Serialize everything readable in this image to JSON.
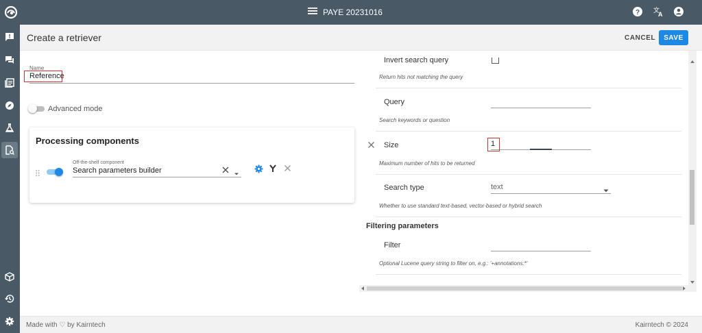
{
  "app": {
    "title": "PAYE 20231016"
  },
  "topbar": {
    "menu_icon": "menu-icon",
    "icons": [
      "help-icon",
      "translate-icon",
      "account-icon"
    ]
  },
  "sidebar": {
    "items": [
      "feedback-icon",
      "forum-icon",
      "documents-icon",
      "explore-icon",
      "flask-icon",
      "retriever-icon",
      "cube-icon",
      "history-icon",
      "settings-icon"
    ],
    "active": "retriever-icon"
  },
  "header": {
    "title": "Create a retriever",
    "cancel_label": "CANCEL",
    "save_label": "SAVE"
  },
  "form": {
    "name_label": "Name",
    "name_value": "Reference",
    "advanced_mode_label": "Advanced mode",
    "advanced_mode_on": false
  },
  "processing": {
    "title": "Processing components",
    "component_label": "Off-the-shelf component",
    "component_value": "Search parameters builder",
    "enabled": true
  },
  "params": {
    "invert": {
      "label": "Invert search query",
      "hint": "Return hits not matching the query",
      "checked": false
    },
    "query": {
      "label": "Query",
      "hint": "Search keywords or question",
      "value": ""
    },
    "size": {
      "label": "Size",
      "hint": "Maximum number of hits to be returned",
      "value": "1"
    },
    "search_type": {
      "label": "Search type",
      "hint": "Whether to use standard text-based, vector-based or hybrid search",
      "value": "text"
    },
    "filtering_title": "Filtering parameters",
    "filter": {
      "label": "Filter",
      "hint": "Optional Lucene query string to filter on, e.g.: '+annotations:*'",
      "value": ""
    }
  },
  "footer": {
    "made_with": "Made with ♡ by Kairntech",
    "copyright": "Kairntech © 2024"
  },
  "colors": {
    "topbar": "#495a66",
    "primary": "#1e88e5",
    "highlight": "#d32f2f"
  }
}
